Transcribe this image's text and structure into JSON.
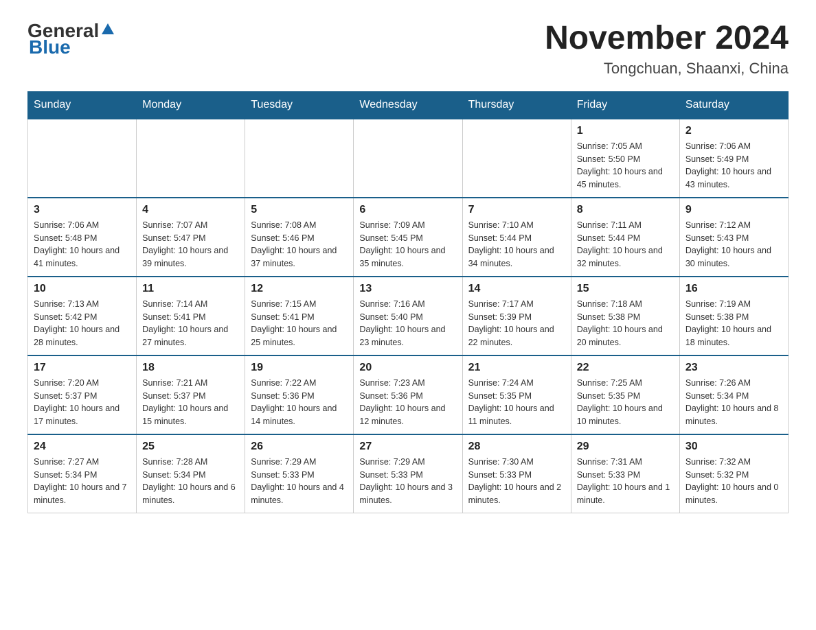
{
  "header": {
    "logo_general": "General",
    "logo_blue": "Blue",
    "title": "November 2024",
    "subtitle": "Tongchuan, Shaanxi, China"
  },
  "calendar": {
    "days_of_week": [
      "Sunday",
      "Monday",
      "Tuesday",
      "Wednesday",
      "Thursday",
      "Friday",
      "Saturday"
    ],
    "weeks": [
      [
        {
          "day": "",
          "info": ""
        },
        {
          "day": "",
          "info": ""
        },
        {
          "day": "",
          "info": ""
        },
        {
          "day": "",
          "info": ""
        },
        {
          "day": "",
          "info": ""
        },
        {
          "day": "1",
          "info": "Sunrise: 7:05 AM\nSunset: 5:50 PM\nDaylight: 10 hours and 45 minutes."
        },
        {
          "day": "2",
          "info": "Sunrise: 7:06 AM\nSunset: 5:49 PM\nDaylight: 10 hours and 43 minutes."
        }
      ],
      [
        {
          "day": "3",
          "info": "Sunrise: 7:06 AM\nSunset: 5:48 PM\nDaylight: 10 hours and 41 minutes."
        },
        {
          "day": "4",
          "info": "Sunrise: 7:07 AM\nSunset: 5:47 PM\nDaylight: 10 hours and 39 minutes."
        },
        {
          "day": "5",
          "info": "Sunrise: 7:08 AM\nSunset: 5:46 PM\nDaylight: 10 hours and 37 minutes."
        },
        {
          "day": "6",
          "info": "Sunrise: 7:09 AM\nSunset: 5:45 PM\nDaylight: 10 hours and 35 minutes."
        },
        {
          "day": "7",
          "info": "Sunrise: 7:10 AM\nSunset: 5:44 PM\nDaylight: 10 hours and 34 minutes."
        },
        {
          "day": "8",
          "info": "Sunrise: 7:11 AM\nSunset: 5:44 PM\nDaylight: 10 hours and 32 minutes."
        },
        {
          "day": "9",
          "info": "Sunrise: 7:12 AM\nSunset: 5:43 PM\nDaylight: 10 hours and 30 minutes."
        }
      ],
      [
        {
          "day": "10",
          "info": "Sunrise: 7:13 AM\nSunset: 5:42 PM\nDaylight: 10 hours and 28 minutes."
        },
        {
          "day": "11",
          "info": "Sunrise: 7:14 AM\nSunset: 5:41 PM\nDaylight: 10 hours and 27 minutes."
        },
        {
          "day": "12",
          "info": "Sunrise: 7:15 AM\nSunset: 5:41 PM\nDaylight: 10 hours and 25 minutes."
        },
        {
          "day": "13",
          "info": "Sunrise: 7:16 AM\nSunset: 5:40 PM\nDaylight: 10 hours and 23 minutes."
        },
        {
          "day": "14",
          "info": "Sunrise: 7:17 AM\nSunset: 5:39 PM\nDaylight: 10 hours and 22 minutes."
        },
        {
          "day": "15",
          "info": "Sunrise: 7:18 AM\nSunset: 5:38 PM\nDaylight: 10 hours and 20 minutes."
        },
        {
          "day": "16",
          "info": "Sunrise: 7:19 AM\nSunset: 5:38 PM\nDaylight: 10 hours and 18 minutes."
        }
      ],
      [
        {
          "day": "17",
          "info": "Sunrise: 7:20 AM\nSunset: 5:37 PM\nDaylight: 10 hours and 17 minutes."
        },
        {
          "day": "18",
          "info": "Sunrise: 7:21 AM\nSunset: 5:37 PM\nDaylight: 10 hours and 15 minutes."
        },
        {
          "day": "19",
          "info": "Sunrise: 7:22 AM\nSunset: 5:36 PM\nDaylight: 10 hours and 14 minutes."
        },
        {
          "day": "20",
          "info": "Sunrise: 7:23 AM\nSunset: 5:36 PM\nDaylight: 10 hours and 12 minutes."
        },
        {
          "day": "21",
          "info": "Sunrise: 7:24 AM\nSunset: 5:35 PM\nDaylight: 10 hours and 11 minutes."
        },
        {
          "day": "22",
          "info": "Sunrise: 7:25 AM\nSunset: 5:35 PM\nDaylight: 10 hours and 10 minutes."
        },
        {
          "day": "23",
          "info": "Sunrise: 7:26 AM\nSunset: 5:34 PM\nDaylight: 10 hours and 8 minutes."
        }
      ],
      [
        {
          "day": "24",
          "info": "Sunrise: 7:27 AM\nSunset: 5:34 PM\nDaylight: 10 hours and 7 minutes."
        },
        {
          "day": "25",
          "info": "Sunrise: 7:28 AM\nSunset: 5:34 PM\nDaylight: 10 hours and 6 minutes."
        },
        {
          "day": "26",
          "info": "Sunrise: 7:29 AM\nSunset: 5:33 PM\nDaylight: 10 hours and 4 minutes."
        },
        {
          "day": "27",
          "info": "Sunrise: 7:29 AM\nSunset: 5:33 PM\nDaylight: 10 hours and 3 minutes."
        },
        {
          "day": "28",
          "info": "Sunrise: 7:30 AM\nSunset: 5:33 PM\nDaylight: 10 hours and 2 minutes."
        },
        {
          "day": "29",
          "info": "Sunrise: 7:31 AM\nSunset: 5:33 PM\nDaylight: 10 hours and 1 minute."
        },
        {
          "day": "30",
          "info": "Sunrise: 7:32 AM\nSunset: 5:32 PM\nDaylight: 10 hours and 0 minutes."
        }
      ]
    ]
  }
}
